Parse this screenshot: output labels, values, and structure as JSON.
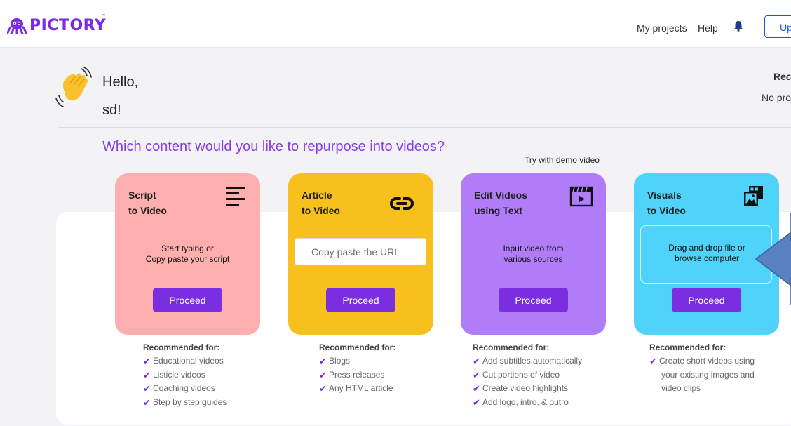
{
  "header": {
    "logo_text": "PICTORY",
    "logo_tm": "™",
    "nav_projects": "My projects",
    "nav_help": "Help",
    "upgrade_label": "Up"
  },
  "greeting": {
    "hello": "Hello,",
    "name": "sd!"
  },
  "recent": {
    "title": "Rece",
    "empty": "No proj"
  },
  "main": {
    "question": "Which content would you like to repurpose into videos?",
    "demo_link": "Try with demo video"
  },
  "cards": [
    {
      "title_line1": "Script",
      "title_line2": "to Video",
      "desc_line1": "Start typing or",
      "desc_line2": "Copy paste your script",
      "button": "Proceed",
      "color": "#fdaeae",
      "icon": "text-lines-icon"
    },
    {
      "title_line1": "Article",
      "title_line2": "to Video",
      "input_placeholder": "Copy paste the URL",
      "button": "Proceed",
      "color": "#f7c01c",
      "icon": "link-icon"
    },
    {
      "title_line1": "Edit Videos",
      "title_line2": "using Text",
      "desc_line1": "Input video from",
      "desc_line2": "various sources",
      "button": "Proceed",
      "color": "#b17cf8",
      "icon": "clapperboard-icon"
    },
    {
      "title_line1": "Visuals",
      "title_line2": "to Video",
      "desc_line1": "Drag and drop file or",
      "desc_line2": "browse computer",
      "button": "Proceed",
      "color": "#4fd3fa",
      "icon": "image-gallery-icon"
    }
  ],
  "recommendations": [
    {
      "title": "Recommended for:",
      "items": [
        "Educational videos",
        "Listicle videos",
        "Coaching videos",
        "Step by step guides"
      ]
    },
    {
      "title": "Recommended for:",
      "items": [
        "Blogs",
        "Press releases",
        "Any HTML article"
      ]
    },
    {
      "title": "Recommended for:",
      "items": [
        "Add subtitles automatically",
        "Cut portions of video",
        "Create video highlights",
        "Add logo, intro, & outro"
      ]
    },
    {
      "title": "Recommended for:",
      "items": [
        "Create short videos using"
      ],
      "continuation": [
        "your existing images and",
        "video clips"
      ]
    }
  ],
  "colors": {
    "brand": "#7c2ae8",
    "button": "#7b2ee0",
    "question": "#8a3ae6"
  }
}
